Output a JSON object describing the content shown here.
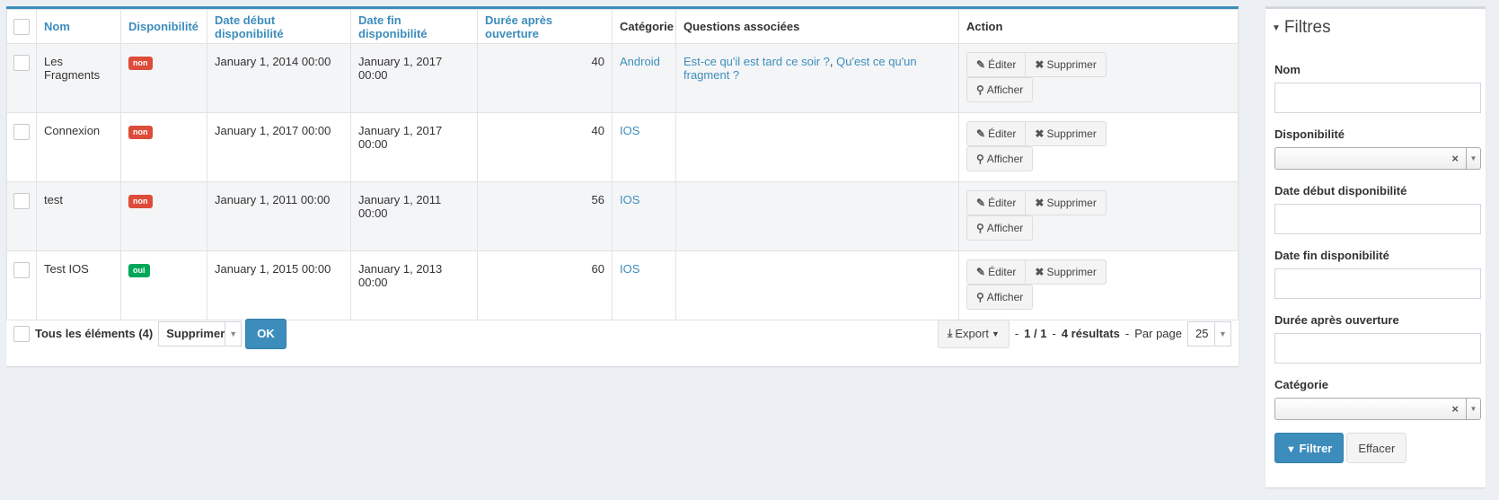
{
  "table": {
    "columns": [
      {
        "label": "Nom"
      },
      {
        "label": "Disponibilité"
      },
      {
        "label": "Date début disponibilité"
      },
      {
        "label": "Date fin disponibilité"
      },
      {
        "label": "Durée après ouverture"
      },
      {
        "label": "Catégorie"
      },
      {
        "label": "Questions associées"
      },
      {
        "label": "Action"
      }
    ],
    "rows": [
      {
        "nom": "Les Fragments",
        "dispo": "non",
        "debut": "January 1, 2014 00:00",
        "fin": "January 1, 2017 00:00",
        "duree": "40",
        "categorie": "Android",
        "q1": "Est-ce qu'il est tard ce soir ?",
        "sep": ", ",
        "q2": "Qu'est ce qu'un fragment ?"
      },
      {
        "nom": "Connexion",
        "dispo": "non",
        "debut": "January 1, 2017 00:00",
        "fin": "January 1, 2017 00:00",
        "duree": "40",
        "categorie": "IOS",
        "q1": "",
        "sep": "",
        "q2": ""
      },
      {
        "nom": "test",
        "dispo": "non",
        "debut": "January 1, 2011 00:00",
        "fin": "January 1, 2011 00:00",
        "duree": "56",
        "categorie": "IOS",
        "q1": "",
        "sep": "",
        "q2": ""
      },
      {
        "nom": "Test IOS",
        "dispo": "oui",
        "debut": "January 1, 2015 00:00",
        "fin": "January 1, 2013 00:00",
        "duree": "60",
        "categorie": "IOS",
        "q1": "",
        "sep": "",
        "q2": ""
      }
    ],
    "actions": {
      "edit": "Éditer",
      "delete": "Supprimer",
      "show": "Afficher"
    }
  },
  "footer": {
    "all_label": "Tous les éléments (4)",
    "batch_value": "Supprimer",
    "ok": "OK",
    "export": "Export",
    "pager_sep1": "-",
    "pager": "1 / 1",
    "pager_sep2": "-",
    "results": "4 résultats",
    "pager_sep3": "-",
    "per_page_label": "Par page",
    "per_page_value": "25"
  },
  "filters": {
    "title": "Filtres",
    "nom": "Nom",
    "dispo": "Disponibilité",
    "debut": "Date début disponibilité",
    "fin": "Date fin disponibilité",
    "duree": "Durée après ouverture",
    "categorie": "Catégorie",
    "filter_btn": "Filtrer",
    "clear_btn": "Effacer"
  },
  "colors": {
    "accent": "#3c8dbc",
    "danger": "#dd4b39",
    "success": "#00a65a"
  }
}
